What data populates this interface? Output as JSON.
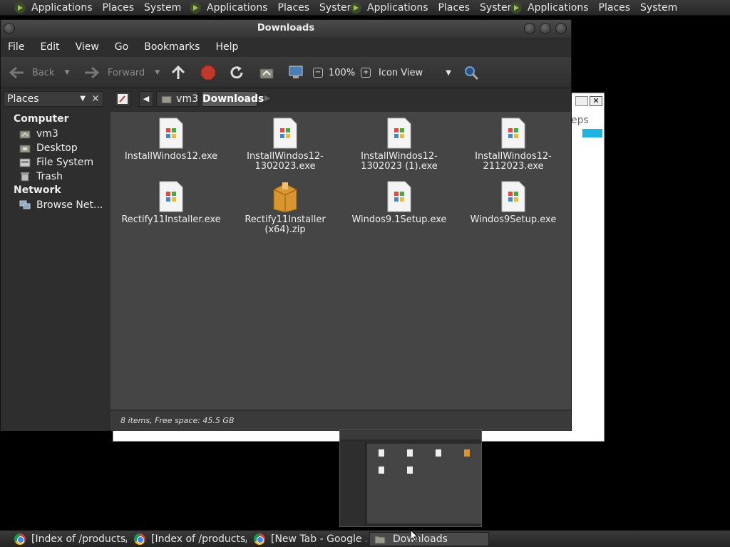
{
  "top_panel": {
    "groups": [
      {
        "applications": "Applications",
        "places": "Places",
        "system": "System"
      },
      {
        "applications": "Applications",
        "places": "Places",
        "system": "System"
      },
      {
        "applications": "Applications",
        "places": "Places",
        "system": "System"
      },
      {
        "applications": "Applications",
        "places": "Places",
        "system": "System"
      }
    ]
  },
  "window": {
    "title": "Downloads",
    "menu": [
      "File",
      "Edit",
      "View",
      "Go",
      "Bookmarks",
      "Help"
    ],
    "toolbar": {
      "back": "Back",
      "forward": "Forward",
      "zoom": "100%",
      "view_mode": "Icon View"
    },
    "location": {
      "crumbs": [
        "vm3",
        "Downloads"
      ]
    },
    "sidebar": {
      "title": "Places",
      "sections": [
        {
          "header": "Computer",
          "items": [
            "vm3",
            "Desktop",
            "File System",
            "Trash"
          ]
        },
        {
          "header": "Network",
          "items": [
            "Browse Net..."
          ]
        }
      ]
    },
    "files": [
      {
        "line1": "InstallWindos12.exe",
        "line2": "",
        "type": "exe"
      },
      {
        "line1": "InstallWindos12-",
        "line2": "1302023.exe",
        "type": "exe"
      },
      {
        "line1": "InstallWindos12-",
        "line2": "1302023 (1).exe",
        "type": "exe"
      },
      {
        "line1": "InstallWindos12-",
        "line2": "2112023.exe",
        "type": "exe"
      },
      {
        "line1": "Rectify11Installer.exe",
        "line2": "",
        "type": "exe"
      },
      {
        "line1": "Rectify11Installer",
        "line2": "(x64).zip",
        "type": "zip"
      },
      {
        "line1": "Windos9.1Setup.exe",
        "line2": "",
        "type": "exe"
      },
      {
        "line1": "Windos9Setup.exe",
        "line2": "",
        "type": "exe"
      }
    ],
    "status": "8 items, Free space: 45.5 GB"
  },
  "background_window": {
    "partial_text": "eps"
  },
  "taskbar": {
    "tasks": [
      {
        "label": "[Index of /products/a...",
        "icon": "chrome-icon"
      },
      {
        "label": "[Index of /products/a...",
        "icon": "chrome-icon"
      },
      {
        "label": "[New Tab - Google ...",
        "icon": "chrome-icon"
      },
      {
        "label": "Downloads",
        "icon": "folder-icon"
      }
    ]
  },
  "colors": {
    "accent_blue": "#1fb3e0",
    "window_bg": "#2e2e2e",
    "content_bg": "#454545"
  }
}
